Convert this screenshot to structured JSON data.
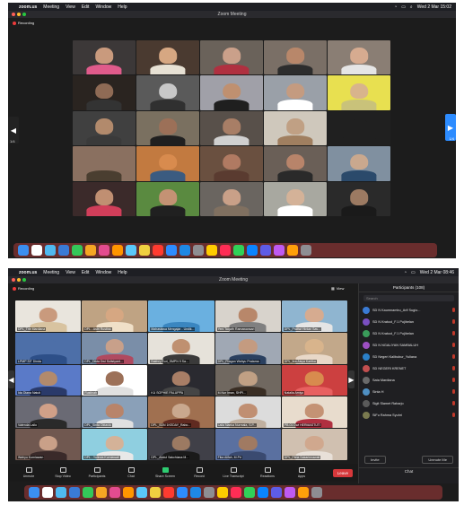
{
  "top": {
    "menubar": {
      "app": "zoom.us",
      "items": [
        "Meeting",
        "View",
        "Edit",
        "Window",
        "Help"
      ],
      "date": "Wed 2 Mar 15:02"
    },
    "window_title": "Zoom Meeting",
    "recording": "Recording",
    "page_left": "1/4",
    "page_right": "1/4",
    "tiles": [
      {
        "bg": "#3c3838",
        "skin": "#c99a7d",
        "shirt": "#e05b8b"
      },
      {
        "bg": "#4a3a30",
        "skin": "#d6a782",
        "shirt": "#e7e1d4"
      },
      {
        "bg": "#6a625a",
        "skin": "#caa08a",
        "shirt": "#b03040"
      },
      {
        "bg": "#7a6f66",
        "skin": "#b8876a",
        "shirt": "#2d2d2d"
      },
      {
        "bg": "#8a7e74",
        "skin": "#d6ab90",
        "shirt": "#e5e5e5"
      },
      {
        "bg": "#2a2420",
        "skin": "#8f6b55",
        "shirt": "#333333"
      },
      {
        "bg": "#5a5a5a",
        "skin": "#c8c8c8",
        "shirt": "#303030"
      },
      {
        "bg": "#a0a0a8",
        "skin": "#bf9070",
        "shirt": "#1f1f1f"
      },
      {
        "bg": "#9aa0a8",
        "skin": "#c49b80",
        "shirt": "#ffffff"
      },
      {
        "bg": "#e8e050",
        "skin": "#d8b48c",
        "shirt": "#c9c27a"
      },
      {
        "bg": "#404040",
        "skin": "#b28a6c",
        "shirt": "#3a3a3a"
      },
      {
        "bg": "#7a7060",
        "skin": "#9c7058",
        "shirt": "#202020"
      },
      {
        "bg": "#58504a",
        "skin": "#a87e66",
        "shirt": "#d0d0d0"
      },
      {
        "bg": "#cfc8bc",
        "skin": "#c0a084",
        "shirt": "#a07f60"
      },
      {
        "bg": "#202020",
        "skin": "#202020",
        "shirt": "#202020"
      },
      {
        "bg": "#8a7060",
        "skin": "#8a7060",
        "shirt": "#4a3e30"
      },
      {
        "bg": "#c27a40",
        "skin": "#d88b4e",
        "shirt": "#3b5b80"
      },
      {
        "bg": "#6a5040",
        "skin": "#b07a62",
        "shirt": "#5a3b30"
      },
      {
        "bg": "#6a5f57",
        "skin": "#b8846a",
        "shirt": "#2a2a2a"
      },
      {
        "bg": "#8090a0",
        "skin": "#c9a88e",
        "shirt": "#2b4a6b"
      },
      {
        "bg": "#3b2a2a",
        "skin": "#c08f72",
        "shirt": "#d13e5a"
      },
      {
        "bg": "#5a8a40",
        "skin": "#c49274",
        "shirt": "#202020"
      },
      {
        "bg": "#6a6560",
        "skin": "#c9a088",
        "shirt": "#807060"
      },
      {
        "bg": "#a8a8a0",
        "skin": "#d4b298",
        "shirt": "#ffffff"
      },
      {
        "bg": "#2a2a2a",
        "skin": "#9c7a62",
        "shirt": "#1a1a1a"
      }
    ]
  },
  "bottom": {
    "menubar": {
      "app": "zoom.us",
      "items": [
        "Meeting",
        "View",
        "Edit",
        "Window",
        "Help"
      ],
      "date": "Wed 2 Mar 08:46"
    },
    "window_title": "Zoom Meeting",
    "recording": "Recording",
    "view_label": "View",
    "tiles": [
      {
        "name": "DPL_Trie Mardiana",
        "bg": "#e9e5dd",
        "skin": "#c99a7d",
        "shirt": "#d8c3a0"
      },
      {
        "name": "DPL - Astri Rustina",
        "bg": "#bfa383",
        "skin": "#d6a782",
        "shirt": "#f0e0c8"
      },
      {
        "name": "Mahasiswa Mengajar - Undik...",
        "bg": "#6ab0e0",
        "skin": "#6ab0e0",
        "shirt": "#3a86c0"
      },
      {
        "name": "Yeni Taqwih Ramawansari",
        "bg": "#d8d3cc",
        "skin": "#b8876a",
        "shirt": "#808080"
      },
      {
        "name": "DPL_Pratiwi Hintan Sav...",
        "bg": "#8fb5d0",
        "skin": "#d6ab90",
        "shirt": "#e5e5e5"
      },
      {
        "name": "LPMP SIT Dinda",
        "bg": "#4d6fa8",
        "skin": "#4d6fa8",
        "shirt": "#2d4f88"
      },
      {
        "name": "DPL_Dikta Dwi Sulistyant...",
        "bg": "#7a8ea8",
        "skin": "#c8a08a",
        "shirt": "#b04a60"
      },
      {
        "name": "Bakhry Ruri_SMPN 9 Sa...",
        "bg": "#e6e2da",
        "skin": "#bf9070",
        "shirt": "#3a3a3a"
      },
      {
        "name": "DPL_Pragan Wahyu Pratama",
        "bg": "#a0a8b4",
        "skin": "#c49b80",
        "shirt": "#2a4060"
      },
      {
        "name": "DPL_Itra Aisya Kartika",
        "bg": "#c2a88a",
        "skin": "#d8b48c",
        "shirt": "#e8d8c8"
      },
      {
        "name": "Ida Diana Natuti",
        "bg": "#5a7ac8",
        "skin": "#b28a6c",
        "shirt": "#2a3a6a"
      },
      {
        "name": "Rustinah",
        "bg": "#ffffff",
        "skin": "#9c7058",
        "shirt": "#e0e0e0"
      },
      {
        "name": "KU SOPHIE PALUPPA",
        "bg": "#2a2a30",
        "skin": "#a87e66",
        "shirt": "#454545"
      },
      {
        "name": "M.Nur Iman, SHPI...",
        "bg": "#706860",
        "skin": "#c0a084",
        "shirt": "#3a2e24"
      },
      {
        "name": "Natalia Amiyo",
        "bg": "#cc4040",
        "skin": "#d88b4e",
        "shirt": "#e86060"
      },
      {
        "name": "Valenda Lailo",
        "bg": "#6a6a74",
        "skin": "#d0a088",
        "shirt": "#2a2a2a"
      },
      {
        "name": "DPL_Sinta Oktavia",
        "bg": "#8aa0b8",
        "skin": "#b8846a",
        "shirt": "#e0e0e0"
      },
      {
        "name": "DPL_SDN 1KEDAY_Rabo...",
        "bg": "#a07050",
        "skin": "#c9a88e",
        "shirt": "#602a20"
      },
      {
        "name": "Laila Naeka Nurmala, S.P...",
        "bg": "#dcdcdc",
        "skin": "#c08f72",
        "shirt": "#c0b0a0"
      },
      {
        "name": "PB.01 Dwi HERMASTUTI",
        "bg": "#e8dccd",
        "skin": "#c49274",
        "shirt": "#b03040"
      },
      {
        "name": "Wahyu Kurniawan",
        "bg": "#705850",
        "skin": "#c9a088",
        "shirt": "#3a2a2a"
      },
      {
        "name": "DPL - Yulinda Kurniawati",
        "bg": "#8fcfe0",
        "skin": "#d4b298",
        "shirt": "#e8e8e8"
      },
      {
        "name": "DPL_Abdul Sakchiana M...",
        "bg": "#404048",
        "skin": "#9c7a62",
        "shirt": "#1a1a1a"
      },
      {
        "name": "Fika Alifah, M.Pd",
        "bg": "#5a70a0",
        "skin": "#a07a62",
        "shirt": "#3a4a70"
      },
      {
        "name": "DPL_Fitria Sakarinnawati",
        "bg": "#d0c0b0",
        "skin": "#d0a88e",
        "shirt": "#e8e0d8"
      }
    ],
    "toolbar": [
      {
        "label": "Unmute",
        "name": "unmute-button"
      },
      {
        "label": "Stop Video",
        "name": "stop-video-button"
      },
      {
        "label": "Participants",
        "name": "participants-button"
      },
      {
        "label": "Chat",
        "name": "chat-button"
      },
      {
        "label": "Share Screen",
        "name": "share-screen-button"
      },
      {
        "label": "Record",
        "name": "record-button"
      },
      {
        "label": "Live Transcript",
        "name": "live-transcript-button"
      },
      {
        "label": "Reactions",
        "name": "reactions-button"
      },
      {
        "label": "Apps",
        "name": "apps-button"
      }
    ],
    "leave": "Leave",
    "participants_panel": {
      "title": "Participants (108)",
      "search": "Search",
      "people": [
        {
          "name": "SD N Kaumnambu_Arif Sugio...",
          "color": "#3a7bd5"
        },
        {
          "name": "SD N Kratool_F.1 Pujibelan",
          "color": "#7a4fc2"
        },
        {
          "name": "SD N Kratool_F.1 Pujibelan",
          "color": "#3a9c5a"
        },
        {
          "name": "SD N NGALIYAN SAMBALUH",
          "color": "#9c4fc2"
        },
        {
          "name": "SD Negeri Kalibubur_Yuliana",
          "color": "#2b80c8"
        },
        {
          "name": "SD NEGERI KRENET",
          "color": "#c24f4f"
        },
        {
          "name": "Sata Mardiana",
          "color": "#6a6a6a"
        },
        {
          "name": "Sinta H",
          "color": "#4f8fc2"
        },
        {
          "name": "Sigit Slamet Raharjo",
          "color": "#5a5a5a"
        },
        {
          "name": "SiFu Rahma Syuhri",
          "color": "#7a7a4f"
        }
      ],
      "invite": "Invite",
      "unmute_me": "Unmute Me",
      "chat": "Chat"
    }
  },
  "dock_colors": [
    "#3b8ff0",
    "#ffffff",
    "#4fb9f0",
    "#3a7bd5",
    "#34c759",
    "#f5a623",
    "#e34c8f",
    "#ff9500",
    "#5ac8fa",
    "#f0d040",
    "#ff3b30",
    "#2d8cff",
    "#1e88e5",
    "#8e8e93",
    "#ffcc00",
    "#ff2d55",
    "#30d158",
    "#0a84ff",
    "#5e5ce6",
    "#bf5af2",
    "#ff9f0a",
    "#8e8e93"
  ]
}
